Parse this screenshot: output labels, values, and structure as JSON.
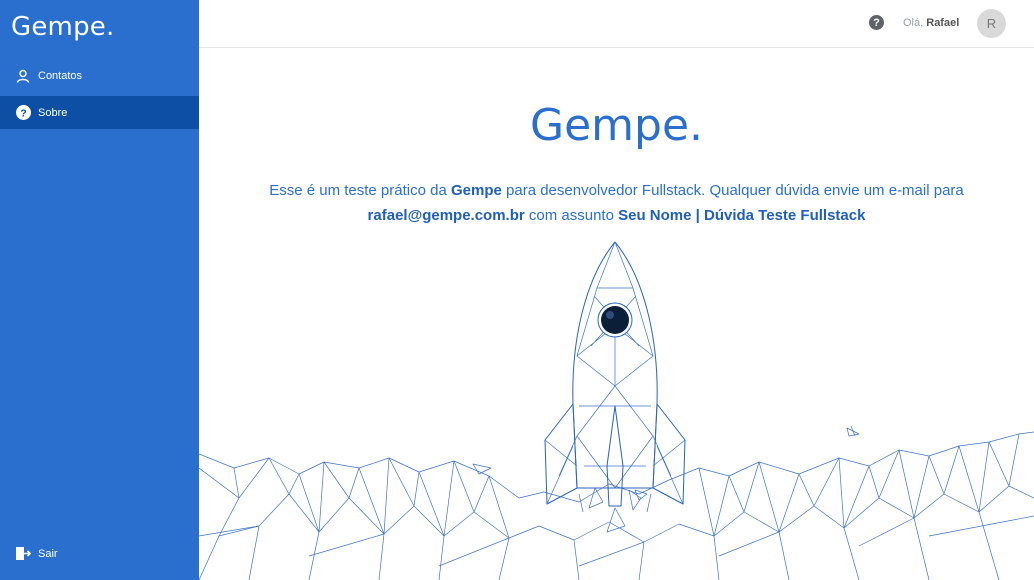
{
  "sidebar": {
    "logo": "Gempe.",
    "items": [
      {
        "label": "Contatos",
        "icon": "user-icon"
      },
      {
        "label": "Sobre",
        "icon": "question-circle-icon",
        "active": true
      }
    ],
    "logout": {
      "label": "Sair",
      "icon": "logout-icon"
    }
  },
  "header": {
    "help_icon": "question-circle-icon",
    "greeting": "Olá,",
    "user_name": "Rafael",
    "avatar_initial": "R"
  },
  "main": {
    "brand": "Gempe.",
    "desc": {
      "part1": "Esse é um teste prático da ",
      "company": "Gempe",
      "part2": " para desenvolvedor Fullstack. Qualquer dúvida envie um e-mail para ",
      "email": "rafael@gempe.com.br",
      "part3": " com assunto ",
      "subject": "Seu Nome | Dúvida Teste Fullstack"
    }
  },
  "colors": {
    "sidebar": "#2a6fce",
    "sidebar_active": "#0c4fa4",
    "accent": "#2a6fce"
  }
}
